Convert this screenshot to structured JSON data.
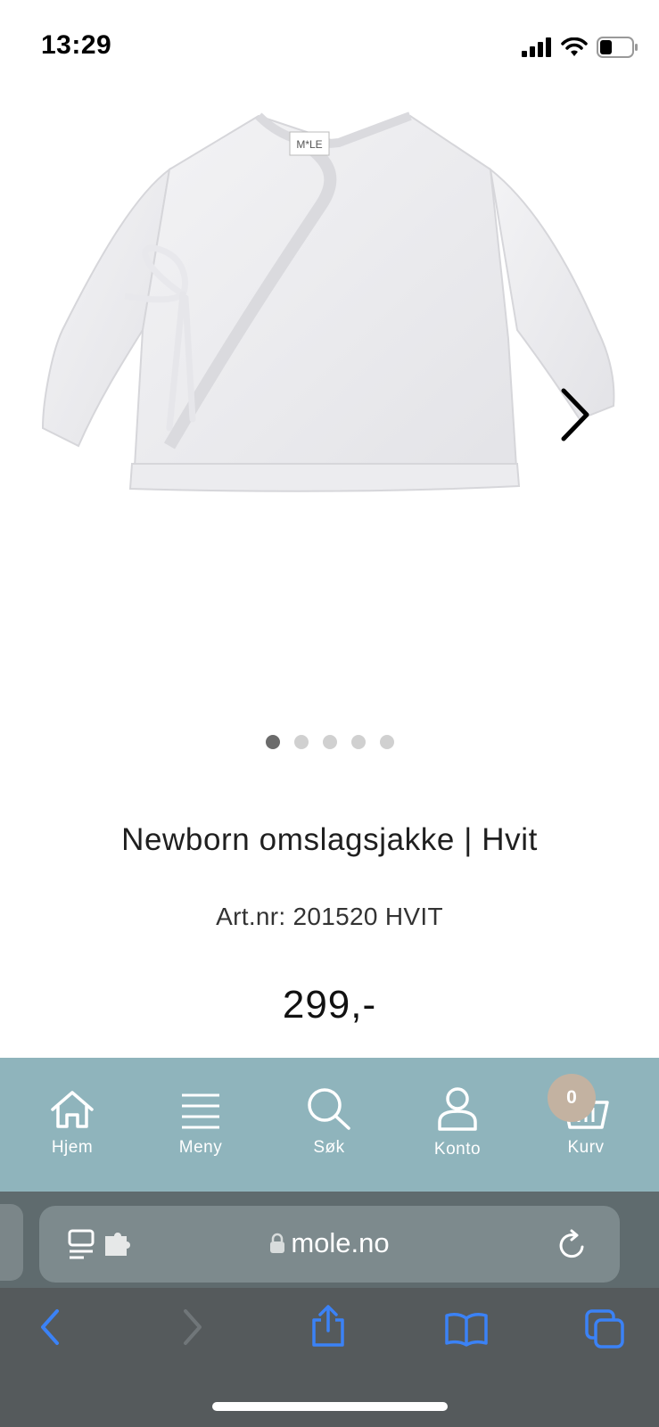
{
  "status": {
    "time": "13:29"
  },
  "gallery": {
    "dots_total": 5,
    "active_dot": 0
  },
  "product": {
    "title": "Newborn omslagsjakke | Hvit",
    "article_no": "Art.nr: 201520 HVIT",
    "price": "299,-"
  },
  "nav": {
    "items": [
      {
        "label": "Hjem",
        "icon": "home-icon"
      },
      {
        "label": "Meny",
        "icon": "menu-icon"
      },
      {
        "label": "Søk",
        "icon": "search-icon"
      },
      {
        "label": "Konto",
        "icon": "account-icon"
      },
      {
        "label": "Kurv",
        "icon": "basket-icon"
      }
    ],
    "cart_count": "0"
  },
  "browser": {
    "url": "mole.no"
  },
  "colors": {
    "nav_bg": "#8fb4bc",
    "badge": "#c3b2a1",
    "browser_accent": "#3b82f6"
  }
}
